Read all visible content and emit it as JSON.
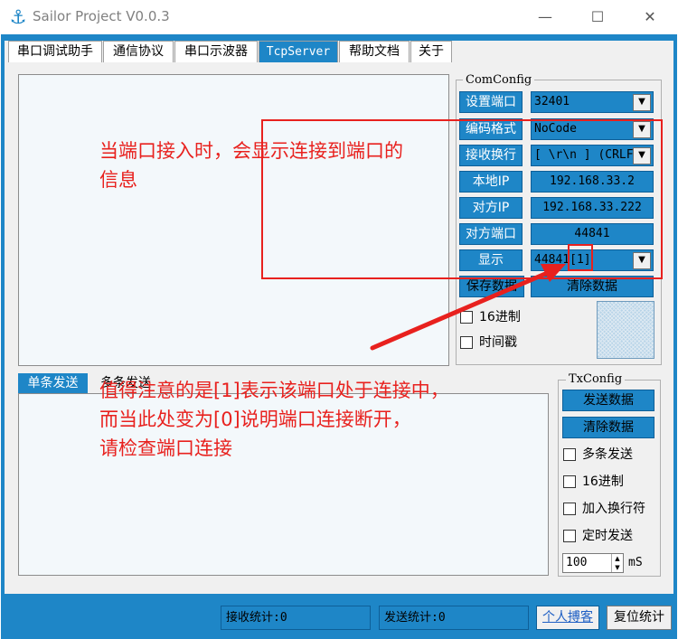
{
  "window": {
    "title": "Sailor Project V0.0.3",
    "icon": "anchor-icon",
    "controls": [
      "minimize-icon",
      "maximize-icon",
      "close-icon"
    ]
  },
  "tabs": [
    {
      "label": "串口调试助手"
    },
    {
      "label": "通信协议"
    },
    {
      "label": "串口示波器"
    },
    {
      "label": "TcpServer",
      "active": true
    },
    {
      "label": "帮助文档"
    },
    {
      "label": "关于"
    }
  ],
  "comconfig": {
    "title": "ComConfig",
    "set_port_label": "设置端口",
    "set_port_value": "32401",
    "encoding_label": "编码格式",
    "encoding_value": "NoCode",
    "line_end_label": "接收换行",
    "line_end_value": "[ \\r\\n ] (CRLF",
    "local_ip_label": "本地IP",
    "local_ip_value": "192.168.33.2",
    "remote_ip_label": "对方IP",
    "remote_ip_value": "192.168.33.222",
    "remote_port_label": "对方端口",
    "remote_port_value": "44841",
    "display_label": "显示",
    "display_value": "44841[1]",
    "save_button": "保存数据",
    "clear_button": "清除数据",
    "hex_label": "16进制",
    "timestamp_label": "时间戳"
  },
  "send_tabs": {
    "single": "单条发送",
    "multi": "多条发送"
  },
  "txconfig": {
    "title": "TxConfig",
    "send_button": "发送数据",
    "clear_button": "清除数据",
    "multi_send_label": "多条发送",
    "hex_label": "16进制",
    "newline_label": "加入换行符",
    "timer_label": "定时发送",
    "interval_value": "100",
    "interval_unit": "mS"
  },
  "status": {
    "rx_count": "接收统计:0",
    "tx_count": "发送统计:0",
    "blog_link": "个人搏客",
    "reset_button": "复位统计"
  },
  "annotations": {
    "top_line1": "当端口接入时，会显示连接到端口的",
    "top_line2": "信息",
    "bottom_line1": "值得注意的是[1]表示该端口处于连接中，",
    "bottom_line2": "而当此处变为[0]说明端口连接断开，",
    "bottom_line3": "请检查端口连接",
    "color": "#E8211E"
  },
  "colors": {
    "accent": "#1E86C7",
    "background": "#F0F0F0",
    "annotation": "#E8211E"
  }
}
